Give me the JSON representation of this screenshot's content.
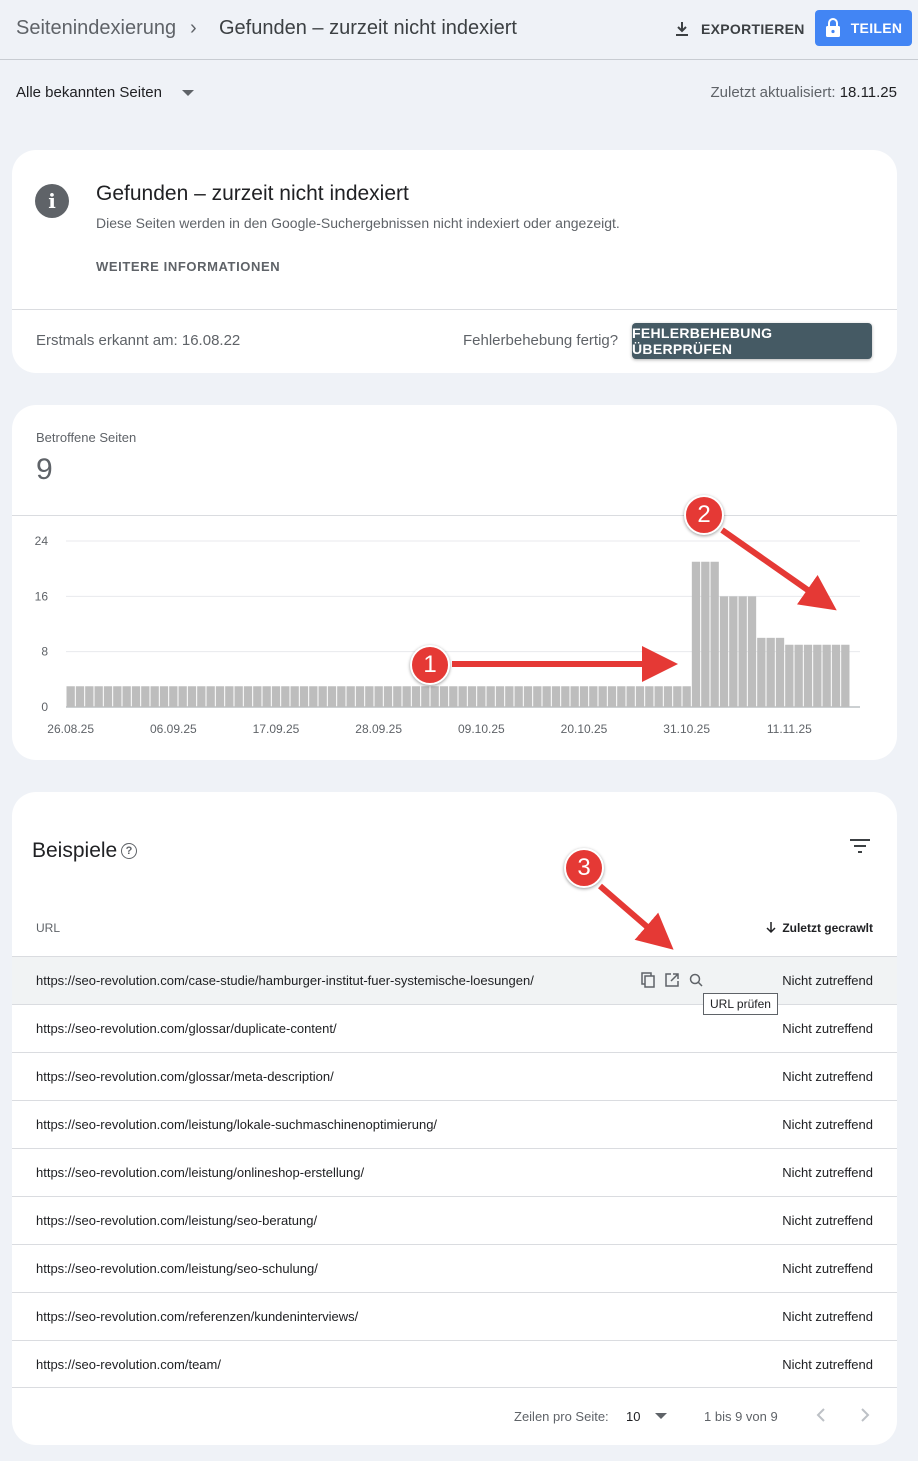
{
  "header": {
    "breadcrumb_root": "Seitenindexierung",
    "breadcrumb_sep": "›",
    "breadcrumb_current": "Gefunden – zurzeit nicht indexiert",
    "export_label": "EXPORTIEREN",
    "share_label": "TEILEN"
  },
  "filter": {
    "selected": "Alle bekannten Seiten",
    "updated_label": "Zuletzt aktualisiert:",
    "updated_value": "18.11.25"
  },
  "issue": {
    "title": "Gefunden – zurzeit nicht indexiert",
    "description": "Diese Seiten werden in den Google-Suchergebnissen nicht indexiert oder angezeigt.",
    "more_label": "WEITERE INFORMATIONEN",
    "first_seen": "Erstmals erkannt am: 16.08.22",
    "fix_question": "Fehlerbehebung fertig?",
    "validate_label": "FEHLERBEHEBUNG ÜBERPRÜFEN"
  },
  "summary": {
    "label": "Betroffene Seiten",
    "count": "9"
  },
  "chart_data": {
    "type": "bar",
    "ylim": [
      0,
      24
    ],
    "y_ticks": [
      "0",
      "8",
      "16",
      "24"
    ],
    "x_ticks": [
      "26.08.25",
      "06.09.25",
      "17.09.25",
      "28.09.25",
      "09.10.25",
      "20.10.25",
      "31.10.25",
      "11.11.25"
    ],
    "x_tick_index": [
      0,
      11,
      22,
      33,
      44,
      55,
      66,
      77
    ],
    "grid": true,
    "bar_color": "#bdbdbd",
    "values": [
      3,
      3,
      3,
      3,
      3,
      3,
      3,
      3,
      3,
      3,
      3,
      3,
      3,
      3,
      3,
      3,
      3,
      3,
      3,
      3,
      3,
      3,
      3,
      3,
      3,
      3,
      3,
      3,
      3,
      3,
      3,
      3,
      3,
      3,
      3,
      3,
      3,
      3,
      3,
      3,
      3,
      3,
      3,
      3,
      3,
      3,
      3,
      3,
      3,
      3,
      3,
      3,
      3,
      3,
      3,
      3,
      3,
      3,
      3,
      3,
      3,
      3,
      3,
      3,
      3,
      3,
      3,
      21,
      21,
      21,
      16,
      16,
      16,
      16,
      10,
      10,
      10,
      9,
      9,
      9,
      9,
      9,
      9,
      9
    ]
  },
  "examples": {
    "heading": "Beispiele",
    "help": "?",
    "col_url": "URL",
    "col_date": "Zuletzt gecrawlt",
    "tooltip": "URL prüfen",
    "rows": [
      {
        "url": "https://seo-revolution.com/case-studie/hamburger-institut-fuer-systemische-loesungen/",
        "crawled": "Nicht zutreffend"
      },
      {
        "url": "https://seo-revolution.com/glossar/duplicate-content/",
        "crawled": "Nicht zutreffend"
      },
      {
        "url": "https://seo-revolution.com/glossar/meta-description/",
        "crawled": "Nicht zutreffend"
      },
      {
        "url": "https://seo-revolution.com/leistung/lokale-suchmaschinenoptimierung/",
        "crawled": "Nicht zutreffend"
      },
      {
        "url": "https://seo-revolution.com/leistung/onlineshop-erstellung/",
        "crawled": "Nicht zutreffend"
      },
      {
        "url": "https://seo-revolution.com/leistung/seo-beratung/",
        "crawled": "Nicht zutreffend"
      },
      {
        "url": "https://seo-revolution.com/leistung/seo-schulung/",
        "crawled": "Nicht zutreffend"
      },
      {
        "url": "https://seo-revolution.com/referenzen/kundeninterviews/",
        "crawled": "Nicht zutreffend"
      },
      {
        "url": "https://seo-revolution.com/team/",
        "crawled": "Nicht zutreffend"
      }
    ],
    "rows_per_page_label": "Zeilen pro Seite:",
    "rows_per_page": "10",
    "range": "1 bis 9 von 9"
  },
  "annotations": [
    {
      "label": "1"
    },
    {
      "label": "2"
    },
    {
      "label": "3"
    }
  ],
  "colors": {
    "accent": "#4285f4",
    "validate_button": "#455a64",
    "annotation": "#e53935"
  }
}
